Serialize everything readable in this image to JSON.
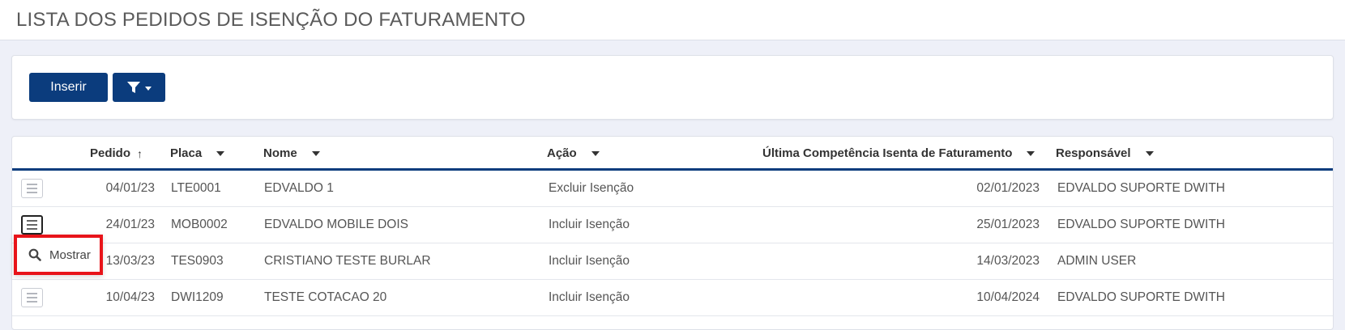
{
  "page": {
    "title": "LISTA DOS PEDIDOS DE ISENÇÃO DO FATURAMENTO"
  },
  "toolbar": {
    "insert_label": "Inserir",
    "filter_icon": "filter-icon"
  },
  "table": {
    "columns": [
      "Pedido",
      "Placa",
      "Nome",
      "Ação",
      "Última Competência Isenta de Faturamento",
      "Responsável"
    ],
    "sort_indicator": "↑",
    "rows": [
      {
        "pedido": "04/01/23",
        "placa": "LTE0001",
        "nome": "EDVALDO 1",
        "acao": "Excluir Isenção",
        "competencia": "02/01/2023",
        "responsavel": "EDVALDO SUPORTE DWITH"
      },
      {
        "pedido": "24/01/23",
        "placa": "MOB0002",
        "nome": "EDVALDO MOBILE DOIS",
        "acao": "Incluir Isenção",
        "competencia": "25/01/2023",
        "responsavel": "EDVALDO SUPORTE DWITH"
      },
      {
        "pedido": "13/03/23",
        "placa": "TES0903",
        "nome": "CRISTIANO TESTE BURLAR",
        "acao": "Incluir Isenção",
        "competencia": "14/03/2023",
        "responsavel": "ADMIN USER"
      },
      {
        "pedido": "10/04/23",
        "placa": "DWI1209",
        "nome": "TESTE COTACAO 20",
        "acao": "Incluir Isenção",
        "competencia": "10/04/2024",
        "responsavel": "EDVALDO SUPORTE DWITH"
      }
    ]
  },
  "row_menu": {
    "show_label": "Mostrar",
    "show_icon": "search-icon"
  },
  "colors": {
    "primary": "#0b3c7d",
    "highlight": "#e8141a"
  }
}
